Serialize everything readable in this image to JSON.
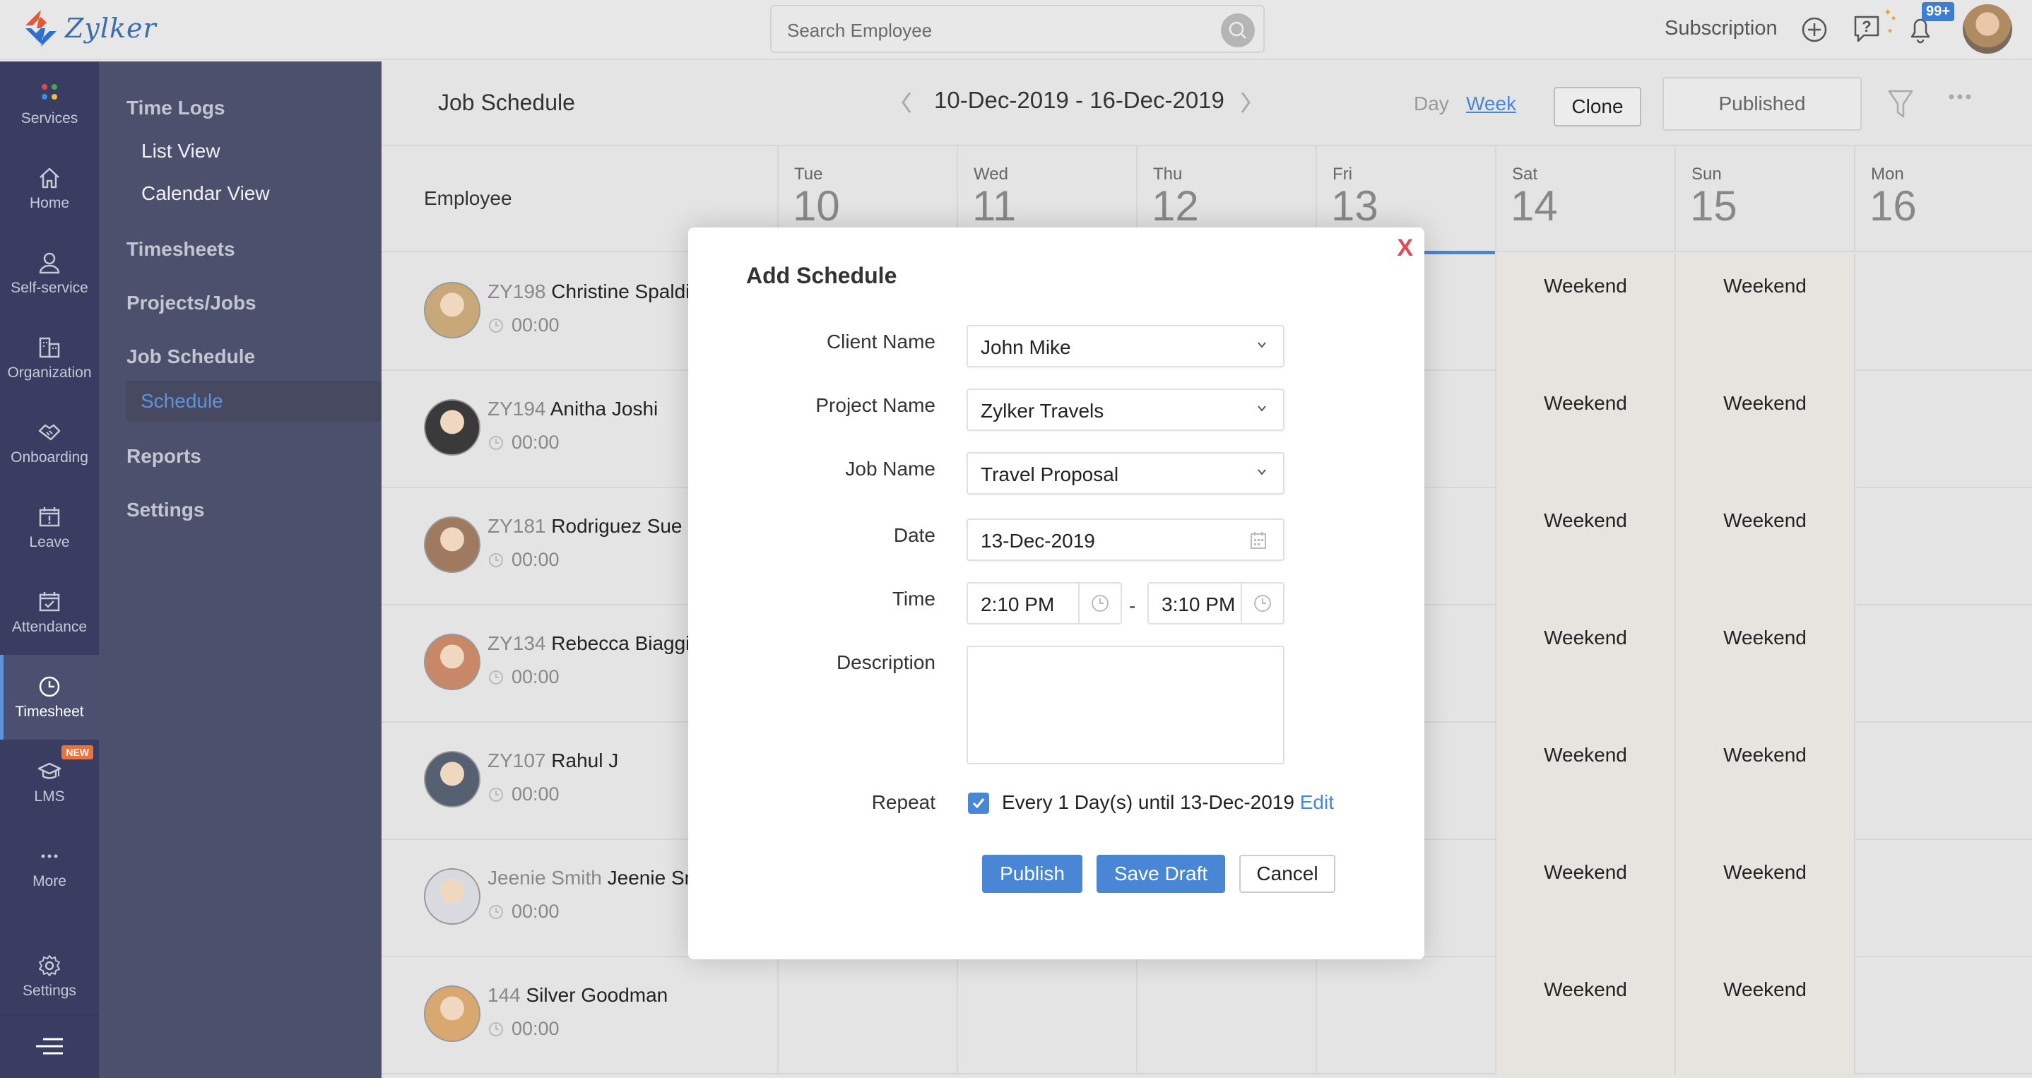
{
  "app": {
    "brand": "Zylker",
    "search_placeholder": "Search Employee",
    "subscription_label": "Subscription",
    "notification_count": "99+"
  },
  "rail": {
    "items": [
      {
        "label": "Services",
        "icon": "services-grid-icon"
      },
      {
        "label": "Home",
        "icon": "home-icon"
      },
      {
        "label": "Self-service",
        "icon": "user-icon"
      },
      {
        "label": "Organization",
        "icon": "building-icon"
      },
      {
        "label": "Onboarding",
        "icon": "handshake-icon"
      },
      {
        "label": "Leave",
        "icon": "calendar-alert-icon"
      },
      {
        "label": "Attendance",
        "icon": "calendar-check-icon"
      },
      {
        "label": "Timesheet",
        "icon": "clock-icon",
        "active": true
      },
      {
        "label": "LMS",
        "icon": "graduation-cap-icon",
        "badge": "NEW"
      },
      {
        "label": "More",
        "icon": "more-dots-icon"
      },
      {
        "label": "Settings",
        "icon": "gear-icon"
      }
    ]
  },
  "submenu": {
    "time_logs": "Time Logs",
    "list_view": "List View",
    "calendar_view": "Calendar View",
    "timesheets": "Timesheets",
    "projects_jobs": "Projects/Jobs",
    "job_schedule": "Job Schedule",
    "schedule": "Schedule",
    "reports": "Reports",
    "settings": "Settings"
  },
  "main": {
    "title": "Job Schedule",
    "date_range": "10-Dec-2019 - 16-Dec-2019",
    "view_day": "Day",
    "view_week": "Week",
    "clone_label": "Clone",
    "published_label": "Published",
    "employee_header": "Employee",
    "days": [
      {
        "name": "Tue",
        "num": "10"
      },
      {
        "name": "Wed",
        "num": "11"
      },
      {
        "name": "Thu",
        "num": "12"
      },
      {
        "name": "Fri",
        "num": "13",
        "today": true
      },
      {
        "name": "Sat",
        "num": "14",
        "weekend": true
      },
      {
        "name": "Sun",
        "num": "15",
        "weekend": true
      },
      {
        "name": "Mon",
        "num": "16"
      }
    ],
    "weekend_label": "Weekend",
    "employees": [
      {
        "id": "ZY198",
        "name": "Christine Spalding",
        "time": "00:00"
      },
      {
        "id": "ZY194",
        "name": "Anitha Joshi",
        "time": "00:00"
      },
      {
        "id": "ZY181",
        "name": "Rodriguez Sue",
        "time": "00:00"
      },
      {
        "id": "ZY134",
        "name": "Rebecca Biaggio",
        "time": "00:00"
      },
      {
        "id": "ZY107",
        "name": "Rahul J",
        "time": "00:00"
      },
      {
        "id": "Jeenie Smith",
        "name": "Jeenie Smith",
        "time": "00:00"
      },
      {
        "id": "144",
        "name": "Silver Goodman",
        "time": "00:00"
      }
    ]
  },
  "modal": {
    "title": "Add Schedule",
    "client_label": "Client Name",
    "client_value": "John Mike",
    "project_label": "Project Name",
    "project_value": "Zylker Travels",
    "job_label": "Job Name",
    "job_value": "Travel Proposal",
    "date_label": "Date",
    "date_value": "13-Dec-2019",
    "time_label": "Time",
    "time_from": "2:10 PM",
    "time_to": "3:10 PM",
    "time_sep": "-",
    "description_label": "Description",
    "description_value": "",
    "repeat_label": "Repeat",
    "repeat_checked": true,
    "repeat_text": "Every 1 Day(s) until 13-Dec-2019",
    "repeat_edit": "Edit",
    "publish_label": "Publish",
    "save_draft_label": "Save Draft",
    "cancel_label": "Cancel",
    "close_glyph": "X"
  },
  "colors": {
    "accent": "#4a86d6",
    "rail_bg": "#393d62",
    "submenu_bg": "#4d506d",
    "close_red": "#e5485a",
    "new_badge": "#e8733e"
  }
}
